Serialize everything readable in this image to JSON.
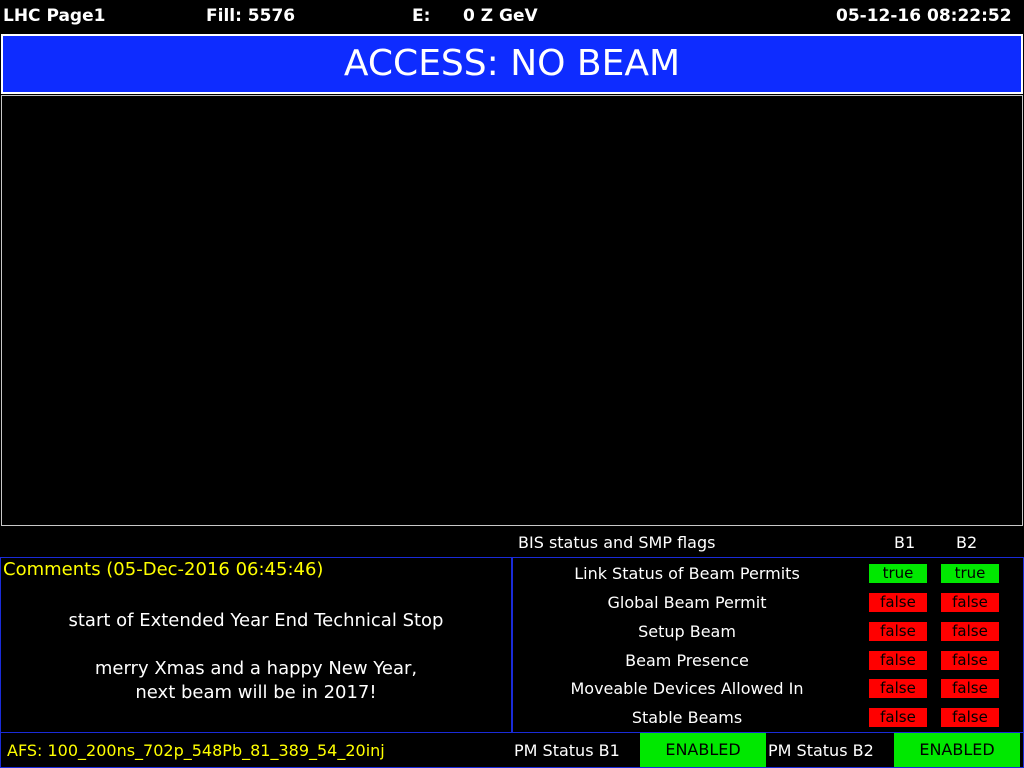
{
  "header": {
    "page": "LHC Page1",
    "fill": "Fill: 5576",
    "energy_label": "E:",
    "energy_value": "0 Z GeV",
    "datetime": "05-12-16 08:22:52"
  },
  "banner": {
    "text": "ACCESS: NO BEAM",
    "color": "#0e2cff"
  },
  "bis": {
    "title": "BIS status and SMP flags",
    "col_b1": "B1",
    "col_b2": "B2",
    "flags": [
      {
        "label": "Link Status of Beam Permits",
        "b1": "true",
        "b2": "true"
      },
      {
        "label": "Global Beam Permit",
        "b1": "false",
        "b2": "false"
      },
      {
        "label": "Setup Beam",
        "b1": "false",
        "b2": "false"
      },
      {
        "label": "Beam Presence",
        "b1": "false",
        "b2": "false"
      },
      {
        "label": "Moveable Devices Allowed In",
        "b1": "false",
        "b2": "false"
      },
      {
        "label": "Stable Beams",
        "b1": "false",
        "b2": "false"
      }
    ],
    "true_color": "#00e800",
    "false_color": "#ff0000"
  },
  "comments": {
    "title": "Comments (05-Dec-2016 06:45:46)",
    "lines": [
      "start of Extended Year End Technical Stop",
      "merry Xmas and a happy New Year,",
      "next beam will be in 2017!"
    ]
  },
  "footer": {
    "afs": "AFS: 100_200ns_702p_548Pb_81_389_54_20inj",
    "pm_b1_label": "PM Status B1",
    "pm_b1_value": "ENABLED",
    "pm_b2_label": "PM Status B2",
    "pm_b2_value": "ENABLED"
  }
}
